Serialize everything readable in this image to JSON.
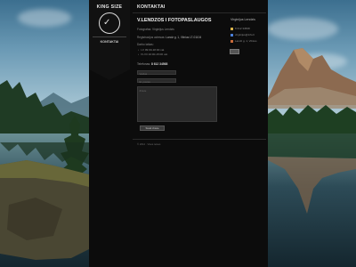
{
  "brand": {
    "name": "KING SIZE"
  },
  "nav": {
    "items": [
      {
        "label": "KONTAKTAI"
      }
    ]
  },
  "page": {
    "title": "KONTAKTAI",
    "company": "V.LENDZOS I FOTOPASLAUGOS",
    "line1": "Fotografas: Virginijus Lendzis",
    "line2_label": "Registracijos adresas:",
    "line2_value": "Landz g. 1, Vilnius LT-01104",
    "hours_label": "Darbo laikas:",
    "hours": [
      "I-V 09:00-18:00 val.",
      "VI-VII 10:00-15:00 val."
    ],
    "phone_label": "Telefonas:",
    "phone_value": "8 612 34568"
  },
  "form": {
    "name_placeholder": "Vardas",
    "email_placeholder": "El. pastas",
    "message_placeholder": "Zinute",
    "submit_label": "Siusti zinute"
  },
  "footer": {
    "text": "© 2012 · Visos teises"
  },
  "sidebar": {
    "title": "Virginijus Lendzis",
    "items": [
      {
        "label": "8 612 34568",
        "icon": "phone-icon",
        "color": "#d8b24a"
      },
      {
        "label": "virginijus@info.lt",
        "icon": "mail-icon",
        "color": "#4a7fd8"
      },
      {
        "label": "Landz g. 1, Vilnius",
        "icon": "home-icon",
        "color": "#c86a3a"
      }
    ]
  },
  "colors": {
    "column": "#0c0c0c",
    "ribbon": "#111111",
    "accent": "#e9e9e9"
  }
}
